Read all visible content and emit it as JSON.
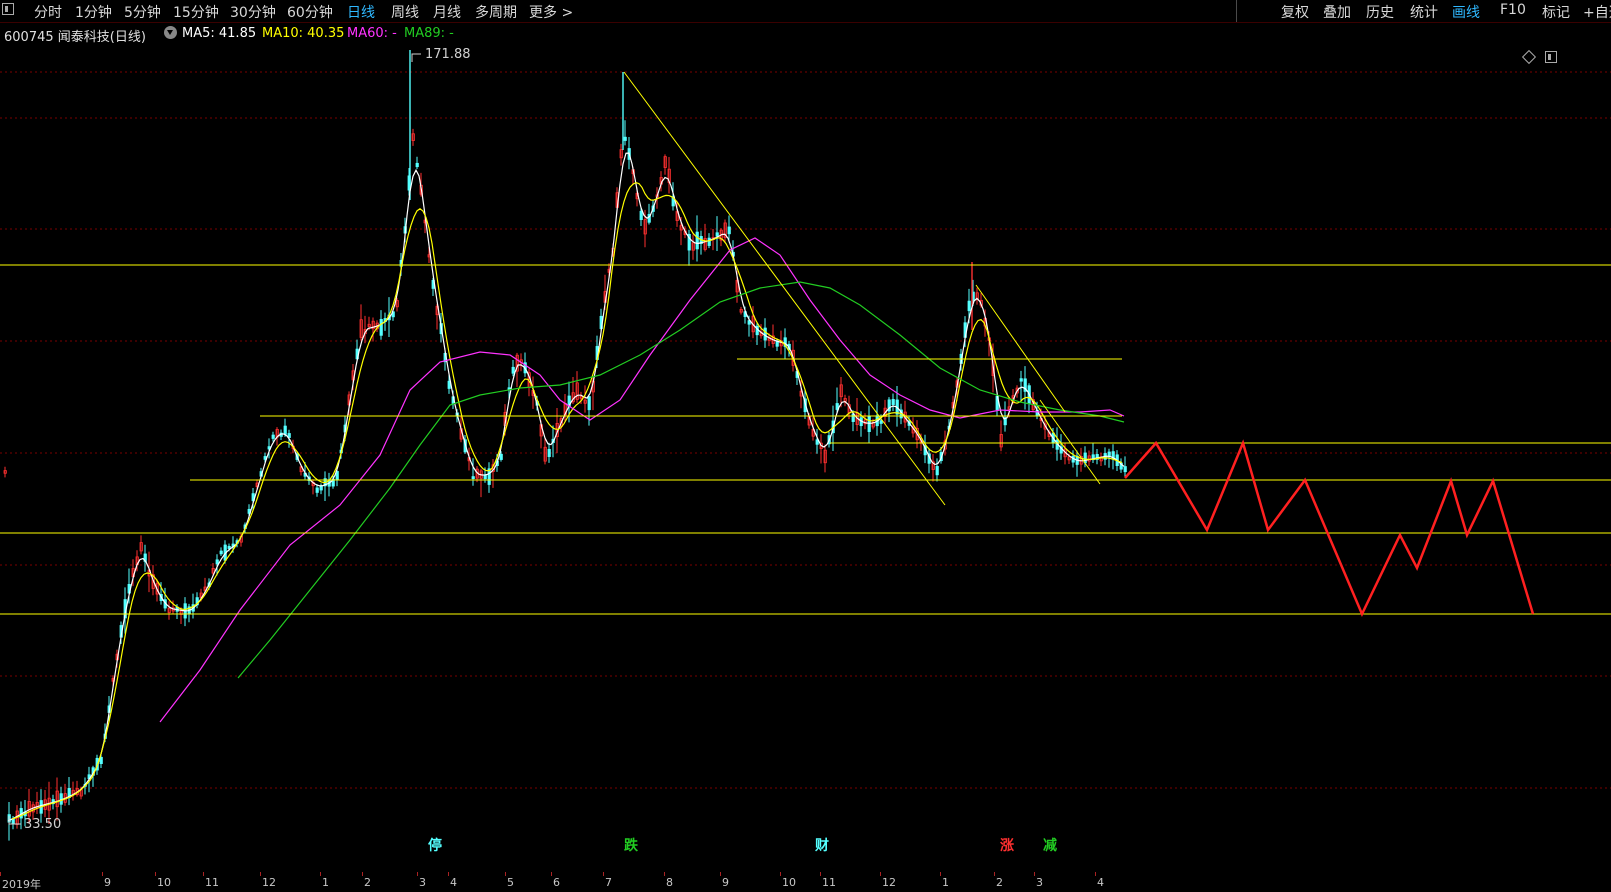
{
  "toolbar": {
    "left_tabs": [
      {
        "label": "分时",
        "active": false
      },
      {
        "label": "1分钟",
        "active": false
      },
      {
        "label": "5分钟",
        "active": false
      },
      {
        "label": "15分钟",
        "active": false
      },
      {
        "label": "30分钟",
        "active": false
      },
      {
        "label": "60分钟",
        "active": false
      },
      {
        "label": "日线",
        "active": true
      },
      {
        "label": "周线",
        "active": false
      },
      {
        "label": "月线",
        "active": false
      },
      {
        "label": "多周期",
        "active": false
      },
      {
        "label": "更多 >",
        "active": false
      }
    ],
    "right_tabs": [
      {
        "label": "复权",
        "active": false
      },
      {
        "label": "叠加",
        "active": false
      },
      {
        "label": "历史",
        "active": false
      },
      {
        "label": "统计",
        "active": false
      },
      {
        "label": "画线",
        "active": true
      },
      {
        "label": "F10",
        "active": false
      },
      {
        "label": "标记",
        "active": false
      },
      {
        "label": "+自选",
        "active": false
      }
    ]
  },
  "info": {
    "symbol": "600745 闻泰科技(日线)",
    "ma5": "MA5: 41.85",
    "ma10": "MA10: 40.35",
    "ma60": "MA60: -",
    "ma89": "MA89: -"
  },
  "colors": {
    "up": "#ff3030",
    "down": "#54ffff",
    "ma5": "#ffffff",
    "ma10": "#ffff00",
    "ma60": "#ff33ff",
    "ma89": "#22cc22",
    "drawing": "#ffff00",
    "projection": "#ff2020",
    "grid": "#7a0000"
  },
  "chart_data": {
    "type": "candlestick",
    "high_label": "171.88",
    "low_label": "33.50",
    "x_axis_labels": [
      "2019年",
      "9",
      "10",
      "11",
      "12",
      "1",
      "2",
      "3",
      "4",
      "5",
      "6",
      "7",
      "8",
      "9",
      "10",
      "11",
      "12",
      "1",
      "2",
      "3",
      "4"
    ],
    "event_tags": [
      {
        "label": "停",
        "color": "#54ffff"
      },
      {
        "label": "跌",
        "color": "#22cc22"
      },
      {
        "label": "财",
        "color": "#54ffff"
      },
      {
        "label": "涨",
        "color": "#ff3030"
      },
      {
        "label": "减",
        "color": "#22cc22"
      }
    ]
  }
}
